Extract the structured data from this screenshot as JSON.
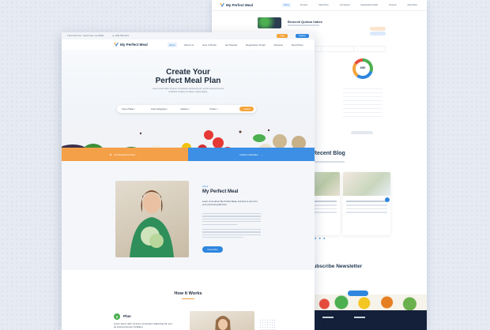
{
  "colors": {
    "accent_orange": "#f3a43b",
    "accent_blue": "#2e86de",
    "dark_navy": "#14203a",
    "brand_green": "#4caf50"
  },
  "front": {
    "topbar": {
      "address": "1234 North Ave., Santa Clara, CA 95051",
      "phone": "+1 (408) 555-0123",
      "login_label": "Login",
      "register_label": "Register"
    },
    "nav": {
      "brand": "My Perfect Meal",
      "links": [
        "Home",
        "About Us",
        "How it Works",
        "Get Started",
        "Registration Detail",
        "Reviews",
        "Meal Plans"
      ],
      "active_index": 0
    },
    "hero": {
      "title_line1": "Create Your",
      "title_line2": "Perfect Meal Plan",
      "description": "Lorem ipsum dolor sit amet, consectetur adipiscing elit, sed do eiusmod tempor incididunt ut labore et dolore magna aliqua.",
      "search": {
        "fields": [
          "Type of Meal",
          "Food Categories",
          "Calories",
          "Protein"
        ],
        "button": "Search"
      }
    },
    "ctas": {
      "left": "Get Registered Now",
      "right": "Calorie Calculator"
    },
    "about": {
      "kicker": "About",
      "title": "My Perfect Meal",
      "lead": "Learn more about My Perfect Meal, and how to use it for your personal goals here.",
      "button": "Know More"
    },
    "how": {
      "title": "How It Works",
      "step_icon": "leaf-icon",
      "step_title": "Plan",
      "step_desc": "Lorem ipsum dolor sit amet, consectetur adipiscing elit, sed do eiusmod tempor incididunt."
    }
  },
  "back": {
    "nav": {
      "brand": "My Perfect Meal",
      "links": [
        "Home",
        "Services",
        "Meal Plans",
        "Get Started",
        "Registration Details",
        "Reviews",
        "Meal Plans"
      ]
    },
    "recipe": {
      "title": "Broccoli Quinoa Cakes",
      "calories": "690"
    },
    "blog_title": "Recent Blog",
    "newsletter_title": "Subscribe Newsletter"
  }
}
